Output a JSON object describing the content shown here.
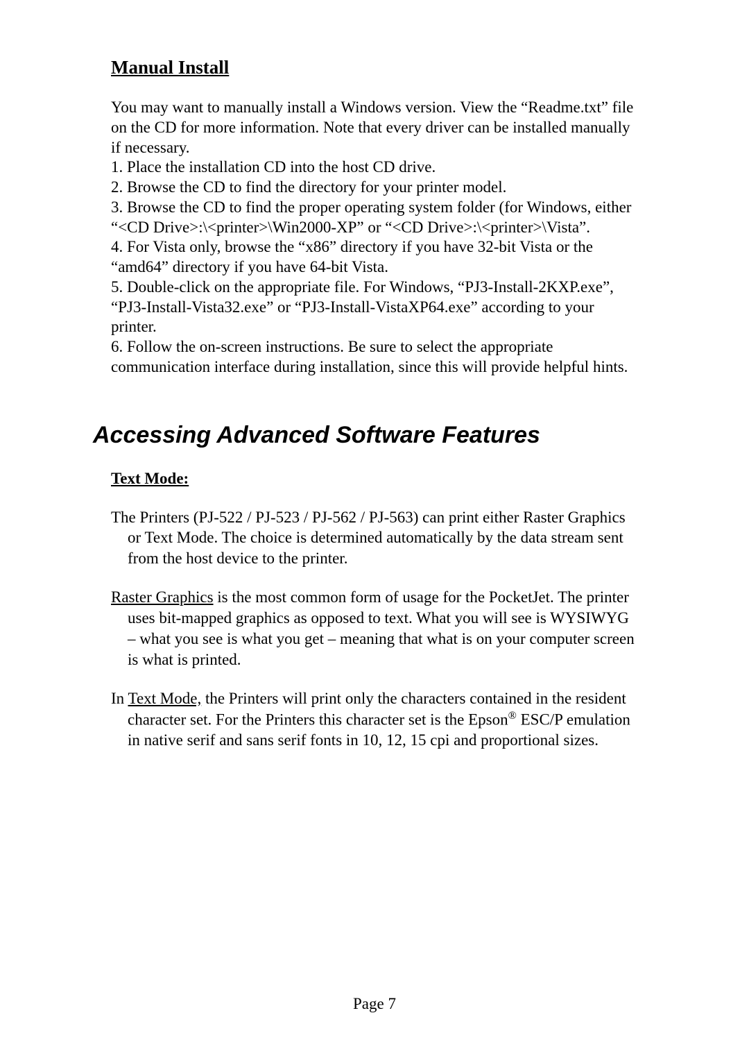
{
  "manual": {
    "heading": "Manual Install",
    "intro": "You may want to manually install a Windows version. View the “Readme.txt” file on the CD for more information. Note that every driver can be installed manually if necessary.",
    "steps": {
      "s1": "1. Place the installation CD into the host CD drive.",
      "s2": "2. Browse the CD to find the directory for your printer model.",
      "s3": "3. Browse the CD to find the proper operating system folder (for Windows, either “<CD Drive>:\\<printer>\\Win2000-XP” or  “<CD Drive>:\\<printer>\\Vista”.",
      "s4": "4. For Vista only, browse the “x86” directory if you have 32-bit Vista or the “amd64” directory if you have 64-bit Vista.",
      "s5": "5. Double-click on the appropriate file. For Windows, “PJ3-Install-2KXP.exe”, “PJ3-Install-Vista32.exe” or “PJ3-Install-VistaXP64.exe” according to your printer.",
      "s6": "6. Follow the on-screen instructions. Be sure to select the appropriate communication interface during installation, since this will provide helpful hints."
    }
  },
  "features": {
    "title": "Accessing Advanced Software Features",
    "textmode_heading": "Text Mode:",
    "intro_para": "The Printers (PJ-522 / PJ-523 / PJ-562 / PJ-563) can print either Raster Graphics or Text Mode.  The choice is determined automatically by the data stream sent from the host device to the printer.",
    "raster": {
      "lead": "Raster Graphics",
      "rest": " is the most common form of usage for the PocketJet.  The printer uses bit-mapped graphics as opposed to text.  What you will see is WYSIWYG – what you see is what you get – meaning that what is on your computer screen is what is printed."
    },
    "textmode": {
      "prefix": "In ",
      "lead": "Text Mode,",
      "mid": " the Printers will print only the characters contained in the resident character set.  For the Printers this character set is the Epson",
      "reg": "®",
      "suffix": " ESC/P emulation in native serif and sans serif fonts in 10, 12, 15 cpi and proportional sizes."
    }
  },
  "page_number": "Page 7"
}
